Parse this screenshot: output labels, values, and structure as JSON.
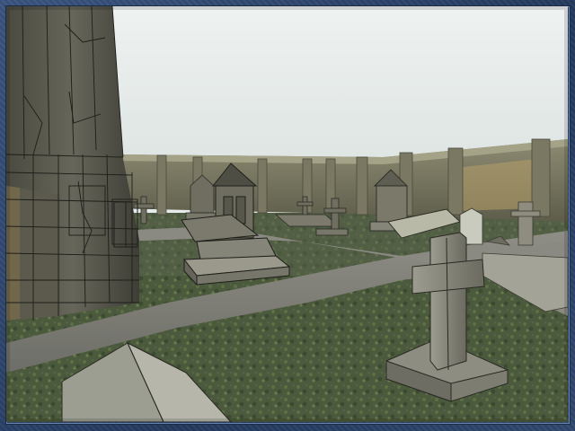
{
  "window": {
    "frame_color": "#2d4468",
    "sky_color": "#e6ecea"
  },
  "scene": {
    "description_icon": "cemetery-scene",
    "elements": [
      {
        "name": "bell-tower",
        "icon": "tower-wireframe"
      },
      {
        "name": "perimeter-wall",
        "icon": "stone-wall"
      },
      {
        "name": "gravel-path",
        "icon": "path"
      },
      {
        "name": "grass-ground",
        "icon": "grass"
      },
      {
        "name": "stone-cross-front",
        "icon": "cross-icon"
      },
      {
        "name": "tomb-shrine-center",
        "icon": "shrine-icon"
      },
      {
        "name": "tomb-shrine-right",
        "icon": "shrine-icon"
      },
      {
        "name": "slab-grave-front",
        "icon": "slab-icon"
      },
      {
        "name": "headstone-right",
        "icon": "headstone-icon"
      }
    ]
  }
}
